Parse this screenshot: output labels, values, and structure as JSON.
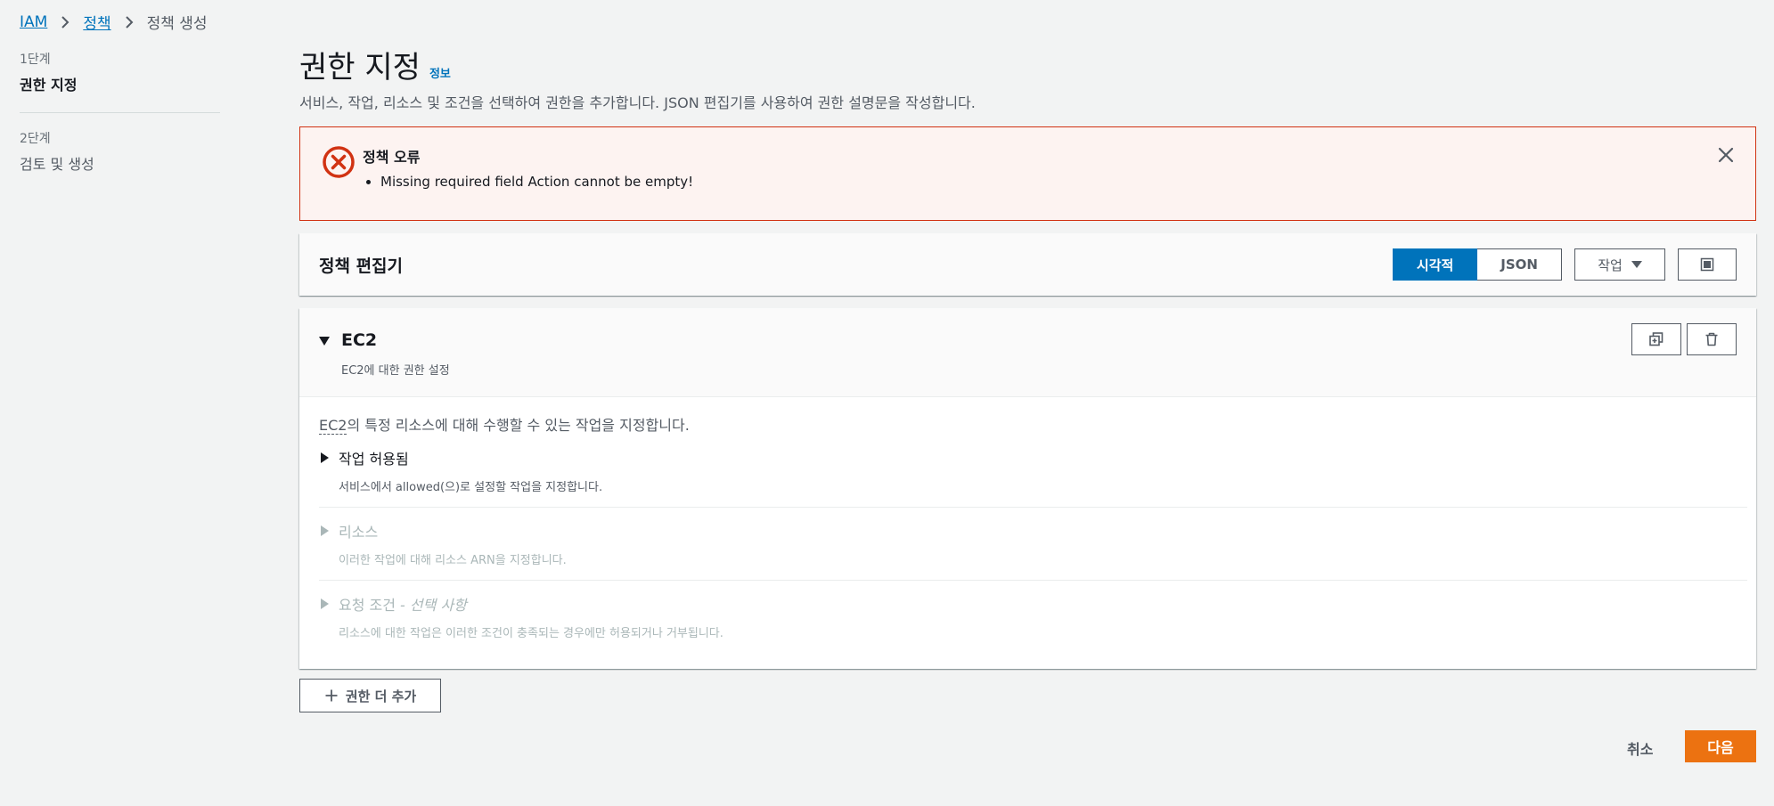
{
  "breadcrumb": {
    "items": [
      "IAM",
      "정책",
      "정책 생성"
    ]
  },
  "steps": [
    {
      "num": "1단계",
      "title": "권한 지정"
    },
    {
      "num": "2단계",
      "title": "검토 및 생성"
    }
  ],
  "header": {
    "title": "권한 지정",
    "info": "정보",
    "description": "서비스, 작업, 리소스 및 조건을 선택하여 권한을 추가합니다. JSON 편집기를 사용하여 권한 설명문을 작성합니다."
  },
  "alert": {
    "title": "정책 오류",
    "items": [
      "Missing required field Action cannot be empty!"
    ]
  },
  "editor": {
    "title": "정책 편집기",
    "visual_label": "시각적",
    "json_label": "JSON",
    "actions_label": "작업"
  },
  "statement": {
    "service": "EC2",
    "subtitle": "EC2에 대한 권한 설정",
    "desc_service": "EC2",
    "desc_rest": "의 특정 리소스에 대해 수행할 수 있는 작업을 지정합니다.",
    "sections": [
      {
        "title": "작업 허용됨",
        "optional": "",
        "desc": "서비스에서 allowed(으)로 설정할 작업을 지정합니다."
      },
      {
        "title": "리소스",
        "optional": "",
        "desc": "이러한 작업에 대해 리소스 ARN을 지정합니다."
      },
      {
        "title": "요청 조건",
        "optional": " - 선택 사항",
        "desc": "리소스에 대한 작업은 이러한 조건이 충족되는 경우에만 허용되거나 거부됩니다."
      }
    ]
  },
  "footer": {
    "add_label": "권한 더 추가",
    "cancel_label": "취소",
    "next_label": "다음"
  },
  "colors": {
    "primary_blue": "#0073bb",
    "error_red": "#d13212",
    "error_bg": "#fdf3f1",
    "next_orange": "#ec7211"
  }
}
